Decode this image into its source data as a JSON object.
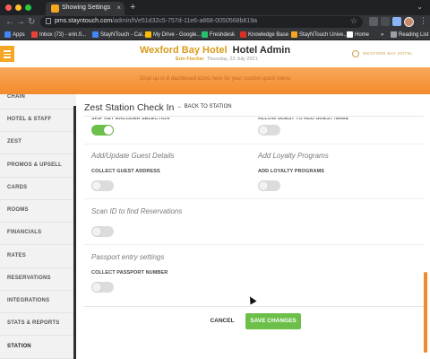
{
  "browser": {
    "tab_title": "Showing Settings",
    "tab_close": "×",
    "new_tab": "+",
    "tab_caret": "⌄",
    "url_host": "pms.stayntouch.com",
    "url_path": "/admin/h/e51d32c5-757d-11e6-a868-0050568b819a",
    "back_icon": "←",
    "forward_icon": "→",
    "reload_icon": "↻",
    "star_icon": "☆",
    "menu_icon": "⋮",
    "bookmarks": [
      {
        "label": "Apps",
        "color": "#4285f4"
      },
      {
        "label": "Inbox (73) - erin.fi...",
        "color": "#ea4335"
      },
      {
        "label": "StayNTouch - Cal...",
        "color": "#4285f4"
      },
      {
        "label": "My Drive - Google...",
        "color": "#fbbc04"
      },
      {
        "label": "Freshdesk",
        "color": "#25c16f"
      },
      {
        "label": "Knowledge Base",
        "color": "#d93025"
      },
      {
        "label": "StayNTouch Unive...",
        "color": "#f5a623"
      },
      {
        "label": "Home",
        "color": "#ffffff"
      },
      {
        "label": "»",
        "color": ""
      },
      {
        "label": "Reading List",
        "color": "#9aa0a6"
      }
    ]
  },
  "header": {
    "hotel_name": "Wexford Bay Hotel",
    "title": "Hotel Admin",
    "user": "Erin Fischer",
    "date": "Thursday, 22 July 2021",
    "logo_text": "WEXFORD BAY HOTEL"
  },
  "quick_menu": {
    "hint": "Drop up to 8 dashboard icons here for your custom quick menu"
  },
  "sidebar": {
    "items": [
      {
        "label": "CHAIN"
      },
      {
        "label": "HOTEL & STAFF"
      },
      {
        "label": "ZEST"
      },
      {
        "label": "PROMOS & UPSELL"
      },
      {
        "label": "CARDS"
      },
      {
        "label": "ROOMS"
      },
      {
        "label": "FINANCIALS"
      },
      {
        "label": "RATES"
      },
      {
        "label": "RESERVATIONS"
      },
      {
        "label": "INTEGRATIONS"
      },
      {
        "label": "STATS & REPORTS"
      },
      {
        "label": "STATION"
      }
    ],
    "active": "STATION"
  },
  "main": {
    "page_title": "Zest Station Check In",
    "back_label": "BACK TO STATION",
    "back_icon": "←",
    "top_left_label": "SKIP KEY ENCODER SELECTION",
    "top_right_label": "ALLOW GUEST TO ADD GUEST NAME",
    "top_left_on": true,
    "top_right_on": false,
    "sections": [
      {
        "heading": "Add/Update Guest Details",
        "label": "COLLECT GUEST ADDRESS",
        "on": false
      },
      {
        "heading": "Add Loyalty Programs",
        "label": "ADD LOYALTY PROGRAMS",
        "on": false
      },
      {
        "heading": "Scan ID to find Reservations",
        "label": "",
        "on": false
      },
      {
        "heading": "Passport entry settings",
        "label": "COLLECT PASSPORT NUMBER",
        "on": false
      }
    ],
    "cancel_label": "CANCEL",
    "save_label": "SAVE CHANGES"
  },
  "colors": {
    "brand_orange": "#f48a2c",
    "hotel_gold": "#d99b1c",
    "toggle_on": "#6cc04a",
    "save_button": "#6cc04a"
  }
}
